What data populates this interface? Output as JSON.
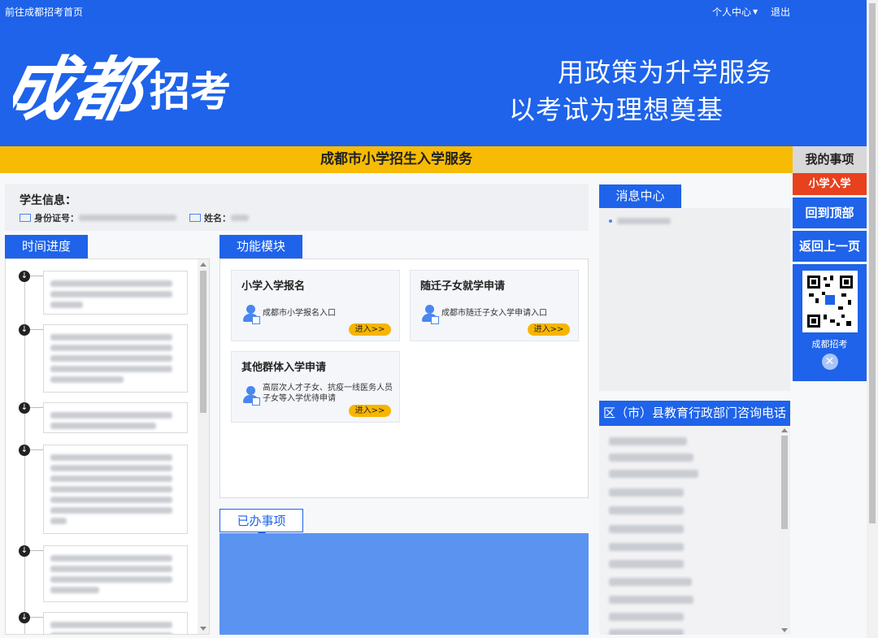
{
  "topbar": {
    "home_link": "前往成都招考首页",
    "user_center": "个人中心",
    "logout": "退出"
  },
  "banner": {
    "logo_text": "成都招考",
    "slogan_line1": "用政策为升学服务",
    "slogan_line2": "以考试为理想奠基"
  },
  "page_title": "成都市小学招生入学服务",
  "side_panel": {
    "header": "我的事项",
    "primary_item": "小学入学",
    "back_to_top": "回到顶部",
    "go_back": "返回上一页",
    "qr_label": "成都招考"
  },
  "student_info": {
    "label": "学生信息：",
    "id_label": "身份证号：",
    "name_label": "姓名："
  },
  "sections": {
    "timeline": "时间进度",
    "functions": "功能模块",
    "messages": "消息中心",
    "done": "已办事项",
    "district_phones": "区（市）县教育行政部门咨询电话"
  },
  "function_cards": [
    {
      "title": "小学入学报名",
      "desc": "成都市小学报名入口",
      "button": "进入>>"
    },
    {
      "title": "随迁子女就学申请",
      "desc": "成都市随迁子女入学申请入口",
      "button": "进入>>"
    },
    {
      "title": "其他群体入学申请",
      "desc": "高层次人才子女、抗疫一线医务人员子女等入学优待申请",
      "button": "进入>>"
    }
  ],
  "colors": {
    "primary_blue": "#1e63ea",
    "title_yellow": "#f7bb04",
    "accent_red": "#e8411e",
    "button_yellow": "#f7b500"
  }
}
